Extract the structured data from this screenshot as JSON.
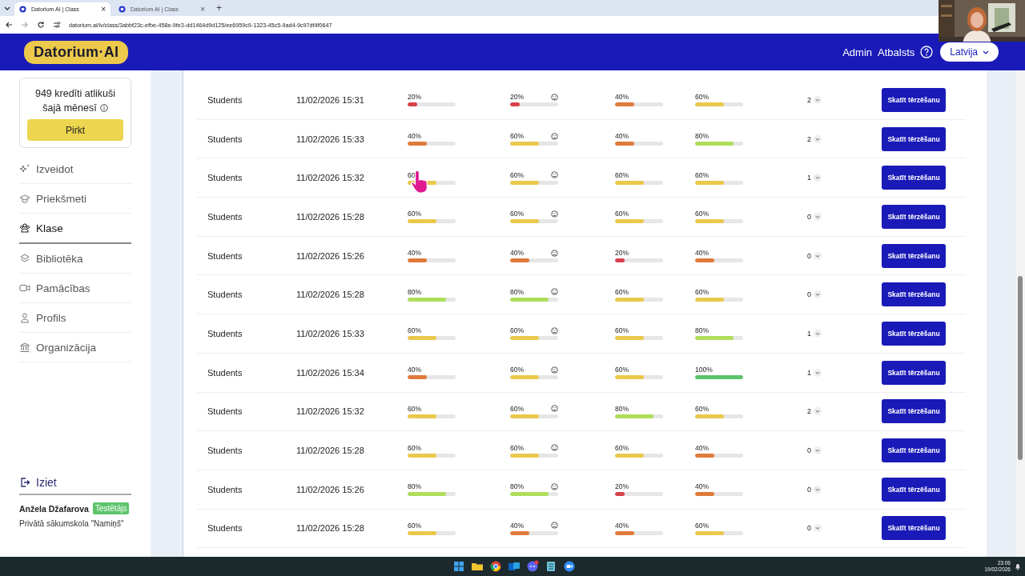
{
  "browser": {
    "tabs": [
      {
        "title": "Datorium AI | Class",
        "close": "×",
        "selected": true
      },
      {
        "title": "Datorium AI | Class",
        "close": "×",
        "selected": false
      }
    ],
    "new_tab": "+",
    "url": "datorium.ai/lv/class/3abbf23c-efbe-458e-9fe3-dd1464d9d125/ee6959c9-1323-45c5-9ad4-9c97df4f0647"
  },
  "header": {
    "logo": "Datorium·AI",
    "links": [
      "Admin",
      "Atbalsts"
    ],
    "language": "Latvija"
  },
  "sidebar": {
    "credits": [
      "949 kredīti atlikuši",
      "šajā mēnesī"
    ],
    "buy": "Pirkt",
    "nav": [
      {
        "label": "Izveidot",
        "selected": false
      },
      {
        "label": "Priekšmeti",
        "selected": false
      },
      {
        "label": "Klase",
        "selected": true
      },
      {
        "label": "Bibliotēka",
        "selected": false
      },
      {
        "label": "Pamācības",
        "selected": false
      },
      {
        "label": "Profils",
        "selected": false
      },
      {
        "label": "Organizācija",
        "selected": false
      }
    ],
    "logout": "Iziet",
    "user": {
      "name": "Anžela Džafarova",
      "role": "Testētājs",
      "school": "Privātā sākumskola \"Namiņš\""
    }
  },
  "table": {
    "rows": [
      {
        "group": "Students",
        "date": "11/02/2026 15:31",
        "scores": [
          {
            "text": "20%",
            "level": 0.2
          },
          {
            "text": "20%",
            "level": 0.2
          },
          {
            "text": "40%",
            "level": 0.4
          },
          {
            "text": "60%",
            "level": 0.6
          }
        ],
        "count": "2",
        "action": "Skatīt tērzēšanu"
      },
      {
        "group": "Students",
        "date": "11/02/2026 15:33",
        "scores": [
          {
            "text": "40%",
            "level": 0.4
          },
          {
            "text": "60%",
            "level": 0.6
          },
          {
            "text": "40%",
            "level": 0.4
          },
          {
            "text": "80%",
            "level": 0.8
          }
        ],
        "count": "2",
        "action": "Skatīt tērzēšanu"
      },
      {
        "group": "Students",
        "date": "11/02/2026 15:32",
        "scores": [
          {
            "text": "60",
            "level": 0.6
          },
          {
            "text": "60%",
            "level": 0.6
          },
          {
            "text": "60%",
            "level": 0.6
          },
          {
            "text": "60%",
            "level": 0.6
          }
        ],
        "count": "1",
        "action": "Skatīt tērzēšanu"
      },
      {
        "group": "Students",
        "date": "11/02/2026 15:28",
        "scores": [
          {
            "text": "60%",
            "level": 0.6
          },
          {
            "text": "60%",
            "level": 0.6
          },
          {
            "text": "60%",
            "level": 0.6
          },
          {
            "text": "60%",
            "level": 0.6
          }
        ],
        "count": "0",
        "action": "Skatīt tērzēšanu"
      },
      {
        "group": "Students",
        "date": "11/02/2026 15:26",
        "scores": [
          {
            "text": "40%",
            "level": 0.4
          },
          {
            "text": "40%",
            "level": 0.4
          },
          {
            "text": "20%",
            "level": 0.2
          },
          {
            "text": "40%",
            "level": 0.4
          }
        ],
        "count": "0",
        "action": "Skatīt tērzēšanu"
      },
      {
        "group": "Students",
        "date": "11/02/2026 15:28",
        "scores": [
          {
            "text": "80%",
            "level": 0.8
          },
          {
            "text": "80%",
            "level": 0.8
          },
          {
            "text": "60%",
            "level": 0.6
          },
          {
            "text": "60%",
            "level": 0.6
          }
        ],
        "count": "0",
        "action": "Skatīt tērzēšanu"
      },
      {
        "group": "Students",
        "date": "11/02/2026 15:33",
        "scores": [
          {
            "text": "60%",
            "level": 0.6
          },
          {
            "text": "60%",
            "level": 0.6
          },
          {
            "text": "60%",
            "level": 0.6
          },
          {
            "text": "80%",
            "level": 0.8
          }
        ],
        "count": "1",
        "action": "Skatīt tērzēšanu"
      },
      {
        "group": "Students",
        "date": "11/02/2026 15:34",
        "scores": [
          {
            "text": "40%",
            "level": 0.4
          },
          {
            "text": "60%",
            "level": 0.6
          },
          {
            "text": "60%",
            "level": 0.6
          },
          {
            "text": "100%",
            "level": 1
          }
        ],
        "count": "1",
        "action": "Skatīt tērzēšanu"
      },
      {
        "group": "Students",
        "date": "11/02/2026 15:32",
        "scores": [
          {
            "text": "60%",
            "level": 0.6
          },
          {
            "text": "60%",
            "level": 0.6
          },
          {
            "text": "80%",
            "level": 0.8
          },
          {
            "text": "60%",
            "level": 0.6
          }
        ],
        "count": "2",
        "action": "Skatīt tērzēšanu"
      },
      {
        "group": "Students",
        "date": "11/02/2026 15:28",
        "scores": [
          {
            "text": "60%",
            "level": 0.6
          },
          {
            "text": "60%",
            "level": 0.6
          },
          {
            "text": "60%",
            "level": 0.6
          },
          {
            "text": "40%",
            "level": 0.4
          }
        ],
        "count": "0",
        "action": "Skatīt tērzēšanu"
      },
      {
        "group": "Students",
        "date": "11/02/2026 15:26",
        "scores": [
          {
            "text": "80%",
            "level": 0.8
          },
          {
            "text": "80%",
            "level": 0.8
          },
          {
            "text": "20%",
            "level": 0.2
          },
          {
            "text": "40%",
            "level": 0.4
          }
        ],
        "count": "0",
        "action": "Skatīt tērzēšanu"
      },
      {
        "group": "Students",
        "date": "11/02/2026 15:28",
        "scores": [
          {
            "text": "60%",
            "level": 0.6
          },
          {
            "text": "40%",
            "level": 0.4
          },
          {
            "text": "40%",
            "level": 0.4
          },
          {
            "text": "60%",
            "level": 0.6
          }
        ],
        "count": "0",
        "action": "Skatīt tērzēšanu"
      }
    ]
  },
  "taskbar": {
    "time": "23:06",
    "date": "19/02/2026"
  }
}
